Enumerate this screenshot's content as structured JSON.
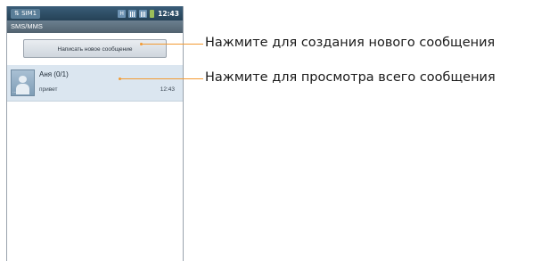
{
  "status_bar": {
    "sim_label": "⇅ SIM1",
    "clock": "12:43",
    "icons": [
      "h-network-icon",
      "signal-bars-icon",
      "signal-bars-icon",
      "battery-icon"
    ],
    "h_label": "H"
  },
  "title_bar": {
    "title": "SMS/MMS"
  },
  "compose": {
    "button_label": "Написать новое сообщение"
  },
  "threads": [
    {
      "name": "Аня (0/1)",
      "preview": "привет",
      "time": "12:43",
      "avatar_dots": "..."
    }
  ],
  "callouts": {
    "compose": "Нажмите для создания нового сообщения",
    "thread": "Нажмите для просмотра всего сообщения"
  },
  "colors": {
    "accent_line": "#f39a32",
    "status_bar": "#2f4f66",
    "title_bar": "#5e7282",
    "selected_row": "#dbe6f0"
  }
}
